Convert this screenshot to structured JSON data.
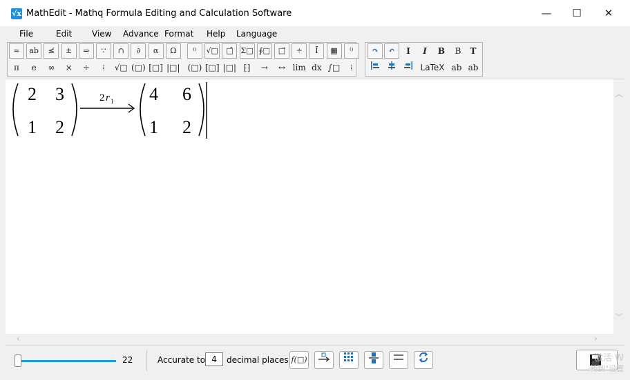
{
  "window": {
    "app_icon": "√x",
    "title": "MathEdit - Mathq Formula Editing and Calculation Software",
    "minimize": "—",
    "maximize": "☐",
    "close": "✕"
  },
  "menu": [
    "File",
    "Edit",
    "View",
    "Advance",
    "Format",
    "Help",
    "Language"
  ],
  "toolbar": {
    "row1": [
      "≈",
      "ab",
      "≰",
      "±",
      "⇒",
      "∵",
      "∩",
      "∂",
      "α",
      "Ω",
      "⁽⁾",
      "√□",
      "□̂",
      "Σ□",
      "∮□",
      "□⃗",
      "÷",
      "Ī",
      "▦",
      "⁽⁾"
    ],
    "row2": [
      "π",
      "e",
      "∞",
      "×",
      "÷",
      "⁞",
      "√□",
      "(□)",
      "[□]",
      "|□|",
      "(□)",
      "[□]",
      "|□|",
      "⁅⁆",
      "→",
      "↔",
      "lim",
      "dx",
      "∫□",
      "⁞"
    ],
    "format_row1": [
      "↷",
      "↶",
      "I",
      "I",
      "B",
      "B",
      "T"
    ],
    "format_row2": [
      "align-left-icon",
      "align-center-icon",
      "align-right-icon"
    ],
    "latex_label": "LaTeX",
    "ab1": "ab",
    "ab2": "ab"
  },
  "formula": {
    "matrix1": [
      [
        "2",
        "3"
      ],
      [
        "1",
        "2"
      ]
    ],
    "arrow_label_coeff": "2",
    "arrow_label_var": "r",
    "arrow_label_sub": "1",
    "matrix2": [
      [
        "4",
        "6"
      ],
      [
        "1",
        "2"
      ]
    ]
  },
  "status": {
    "zoom_percent": 22,
    "zoom_value": "22",
    "accuracy_prefix": "Accurate to",
    "accuracy_value": "4",
    "accuracy_suffix": "decimal places",
    "func_button": "f(□)",
    "watermark_line1": "激活 W",
    "watermark_line2": "转到\"设置"
  },
  "colors": {
    "accent": "#1e9ae0",
    "icon_blue": "#1a6fc0"
  }
}
